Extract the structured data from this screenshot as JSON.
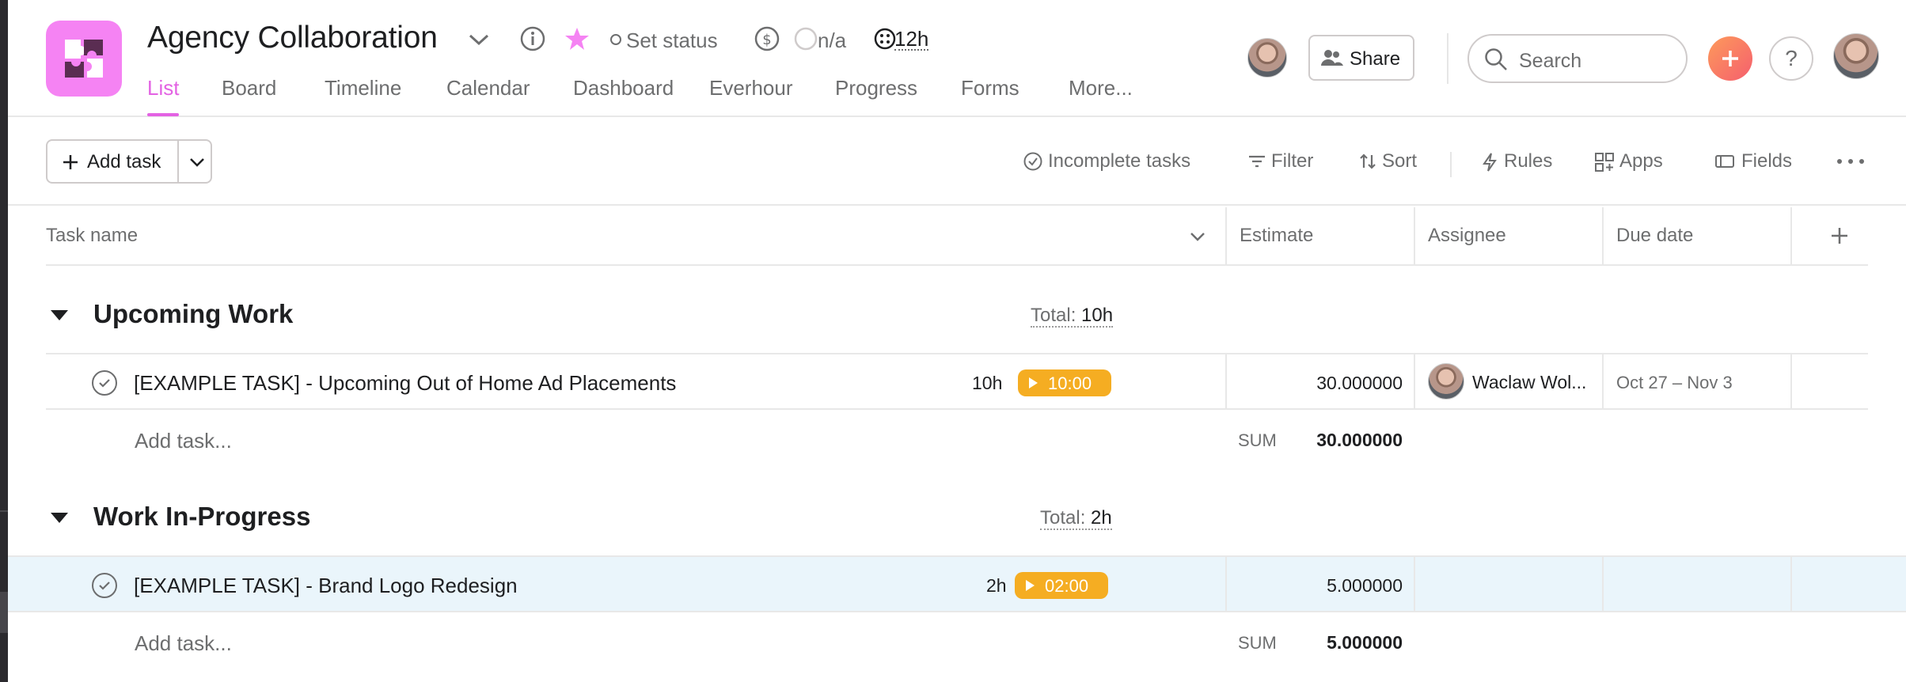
{
  "project": {
    "title": "Agency Collaboration",
    "status_label": "Set status",
    "cost_label": "n/a",
    "time_label": "12h",
    "brand_color": "#f583f3"
  },
  "tabs": [
    {
      "label": "List",
      "active": true
    },
    {
      "label": "Board",
      "active": false
    },
    {
      "label": "Timeline",
      "active": false
    },
    {
      "label": "Calendar",
      "active": false
    },
    {
      "label": "Dashboard",
      "active": false
    },
    {
      "label": "Everhour",
      "active": false
    },
    {
      "label": "Progress",
      "active": false
    },
    {
      "label": "Forms",
      "active": false
    },
    {
      "label": "More...",
      "active": false
    }
  ],
  "topbar": {
    "share_label": "Share",
    "search_placeholder": "Search",
    "help_label": "?"
  },
  "toolbar": {
    "add_task_label": "Add task",
    "incomplete_label": "Incomplete tasks",
    "filter_label": "Filter",
    "sort_label": "Sort",
    "rules_label": "Rules",
    "apps_label": "Apps",
    "fields_label": "Fields"
  },
  "columns": {
    "task_name": "Task name",
    "estimate": "Estimate",
    "assignee": "Assignee",
    "due_date": "Due date"
  },
  "sections": [
    {
      "title": "Upcoming Work",
      "total_label": "Total:",
      "total_value": "10h",
      "tasks": [
        {
          "name": "[EXAMPLE TASK] - Upcoming Out of Home Ad Placements",
          "time": "10h",
          "timer": "10:00",
          "estimate": "30.000000",
          "assignee": "Waclaw Wol...",
          "due": "Oct 27 – Nov 3"
        }
      ],
      "add_task_label": "Add task...",
      "sum_label": "SUM",
      "sum_value": "30.000000"
    },
    {
      "title": "Work In-Progress",
      "total_label": "Total:",
      "total_value": "2h",
      "tasks": [
        {
          "name": "[EXAMPLE TASK] - Brand Logo Redesign",
          "time": "2h",
          "timer": "02:00",
          "estimate": "5.000000",
          "assignee": "",
          "due": ""
        }
      ],
      "add_task_label": "Add task...",
      "sum_label": "SUM",
      "sum_value": "5.000000"
    }
  ],
  "colors": {
    "accent": "#e362e3",
    "timer": "#f5ad22",
    "highlight_row": "#eaf5fb"
  }
}
